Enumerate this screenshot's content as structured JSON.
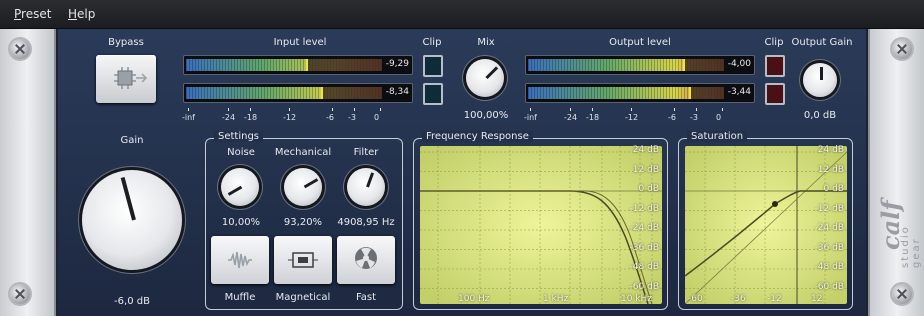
{
  "menu": {
    "preset": "Preset",
    "preset_u": "P",
    "preset_rest": "reset",
    "help": "Help",
    "help_u": "H",
    "help_rest": "elp"
  },
  "bypass": {
    "label": "Bypass"
  },
  "input": {
    "label": "Input level",
    "ch1_value": "-9,29",
    "ch2_value": "-8,34",
    "ch1_level": 0.62,
    "ch2_level": 0.7
  },
  "output": {
    "label": "Output level",
    "ch1_value": "-4,00",
    "ch2_value": "-3,44",
    "ch1_level": 0.8,
    "ch2_level": 0.83
  },
  "clip_label": "Clip",
  "scale": [
    "-inf",
    "-24",
    "-18",
    "-12",
    "-6",
    "-3",
    "0"
  ],
  "mix": {
    "label": "Mix",
    "value": "100,00%"
  },
  "output_gain": {
    "label": "Output Gain",
    "value": "0,0 dB"
  },
  "gain": {
    "label": "Gain",
    "value": "-6,0 dB"
  },
  "settings": {
    "title": "Settings",
    "noise": {
      "label": "Noise",
      "value": "10,00%"
    },
    "mechanical": {
      "label": "Mechanical",
      "value": "93,20%"
    },
    "filter": {
      "label": "Filter",
      "value": "4908,95 Hz"
    },
    "buttons": [
      "Muffle",
      "Magnetical",
      "Fast"
    ]
  },
  "freq": {
    "title": "Frequency Response",
    "db_labels": [
      "24 dB",
      "12 dB",
      "0 dB",
      "-12 dB",
      "-24 dB",
      "-36 dB",
      "-48 dB",
      "-60 dB"
    ],
    "x_labels": [
      "100 Hz",
      "1 kHz",
      "10 kHz"
    ]
  },
  "saturation": {
    "title": "Saturation",
    "db_labels": [
      "24 dB",
      "12 dB",
      "0 dB",
      "-12 dB",
      "-24 dB",
      "-36 dB",
      "-48 dB",
      "-60 dB"
    ],
    "x_labels": [
      "-60",
      "-36",
      "-12",
      "12"
    ]
  },
  "logo": {
    "brand": "calf",
    "sub": "studio gear"
  },
  "colors": {
    "panel": "#22304b",
    "graph": "#d9e58a",
    "curve": "#4a4a22"
  }
}
